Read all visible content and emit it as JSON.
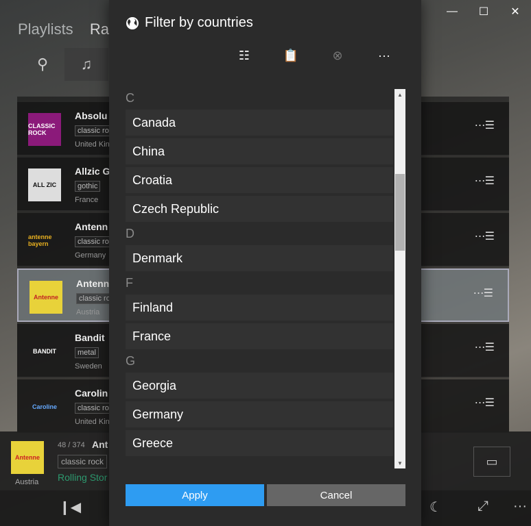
{
  "background": {
    "pivot": [
      "Playlists",
      "Ra"
    ],
    "rows": [
      {
        "title": "Absolu",
        "tag": "classic ro",
        "country": "United Kin",
        "logo": "CLASSIC ROCK",
        "logo_bg": "#8b1a7a",
        "logo_fg": "#ffffff"
      },
      {
        "title": "Allzic G",
        "tag": "gothic",
        "country": "France",
        "logo": "ALL ZIC",
        "logo_bg": "#dddddd",
        "logo_fg": "#111111"
      },
      {
        "title": "Antenn",
        "tag": "classic ro",
        "country": "Germany",
        "logo": "antenne bayern",
        "logo_bg": "transparent",
        "logo_fg": "#e8b020"
      },
      {
        "title": "Antenn",
        "tag": "classic ro",
        "country": "Austria",
        "logo": "Antenne",
        "logo_bg": "#e8d23a",
        "logo_fg": "#c22222"
      },
      {
        "title": "Bandit",
        "tag": "metal",
        "country": "Sweden",
        "logo": "BANDIT",
        "logo_bg": "transparent",
        "logo_fg": "#ffffff"
      },
      {
        "title": "Carolin",
        "tag": "classic ro",
        "country": "United Kin",
        "logo": "Caroline",
        "logo_bg": "transparent",
        "logo_fg": "#66aaff"
      }
    ],
    "now_playing": {
      "count": "48 / 374",
      "title": "Ant",
      "tag": "classic rock",
      "song": "Rolling Stor",
      "country": "Austria",
      "logo": "Antenne"
    }
  },
  "dialog": {
    "title": "Filter by countries",
    "toolbar": [
      {
        "name": "select-all-icon",
        "glyph": "☷",
        "disabled": false
      },
      {
        "name": "clipboard-icon",
        "glyph": "📋",
        "disabled": true
      },
      {
        "name": "clear-icon",
        "glyph": "⊗",
        "disabled": true
      },
      {
        "name": "more-icon",
        "glyph": "···",
        "disabled": false
      }
    ],
    "groups": [
      {
        "letter": "C",
        "countries": [
          "Canada",
          "China",
          "Croatia",
          "Czech Republic"
        ]
      },
      {
        "letter": "D",
        "countries": [
          "Denmark"
        ]
      },
      {
        "letter": "F",
        "countries": [
          "Finland",
          "France"
        ]
      },
      {
        "letter": "G",
        "countries": [
          "Georgia",
          "Germany",
          "Greece"
        ]
      }
    ],
    "apply_label": "Apply",
    "cancel_label": "Cancel"
  }
}
